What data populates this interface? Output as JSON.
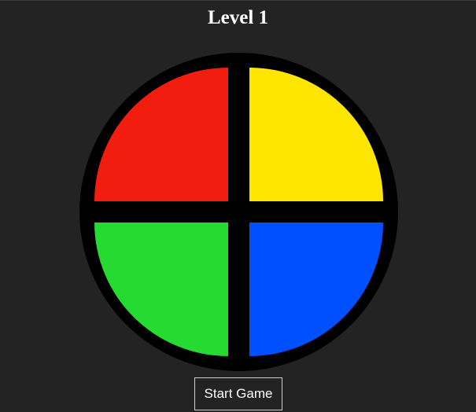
{
  "header": {
    "level_title": "Level 1"
  },
  "board": {
    "pads": [
      {
        "name": "red",
        "color": "#F21D0E"
      },
      {
        "name": "yellow",
        "color": "#FFE600"
      },
      {
        "name": "green",
        "color": "#25DA30"
      },
      {
        "name": "blue",
        "color": "#0050FF"
      }
    ],
    "ring_color": "#000000",
    "background_color": "#232323"
  },
  "controls": {
    "start_label": "Start Game"
  }
}
